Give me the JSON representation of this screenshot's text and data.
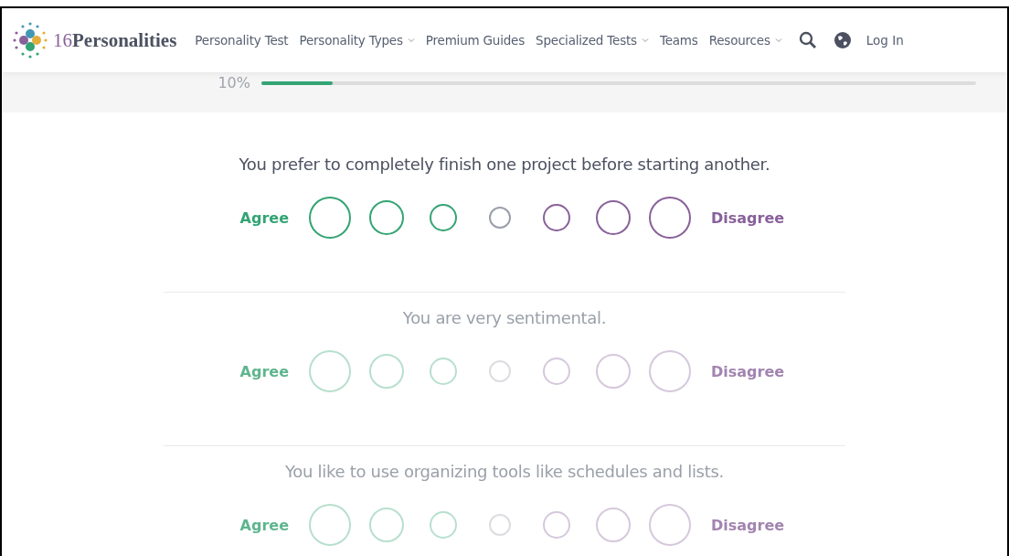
{
  "header": {
    "logo": {
      "number": "16",
      "name": "Personalities"
    },
    "nav": [
      {
        "label": "Personality Test",
        "dropdown": false
      },
      {
        "label": "Personality Types",
        "dropdown": true
      },
      {
        "label": "Premium Guides",
        "dropdown": false
      },
      {
        "label": "Specialized Tests",
        "dropdown": true
      },
      {
        "label": "Teams",
        "dropdown": false
      },
      {
        "label": "Resources",
        "dropdown": true
      }
    ],
    "login": "Log In"
  },
  "progress": {
    "reading": "10%",
    "level": 0.1
  },
  "questions": [
    {
      "text": "You prefer to completely finish one project before starting another.",
      "active": true,
      "agree_label": "Agree",
      "disagree_label": "Disagree",
      "options": [
        {
          "selected": false
        },
        {
          "selected": false
        },
        {
          "selected": false
        },
        {
          "selected": false
        },
        {
          "selected": false
        },
        {
          "selected": false
        },
        {
          "selected": false
        }
      ]
    },
    {
      "text": "You are very sentimental.",
      "active": false,
      "agree_label": "Agree",
      "disagree_label": "Disagree",
      "options": [
        {
          "selected": false
        },
        {
          "selected": false
        },
        {
          "selected": false
        },
        {
          "selected": false
        },
        {
          "selected": false
        },
        {
          "selected": false
        },
        {
          "selected": false
        }
      ]
    },
    {
      "text": "You like to use organizing tools like schedules and lists.",
      "active": false,
      "agree_label": "Agree",
      "disagree_label": "Disagree",
      "options": [
        {
          "selected": false
        },
        {
          "selected": false
        },
        {
          "selected": false
        },
        {
          "selected": false
        },
        {
          "selected": false
        },
        {
          "selected": false
        },
        {
          "selected": false
        }
      ]
    }
  ]
}
